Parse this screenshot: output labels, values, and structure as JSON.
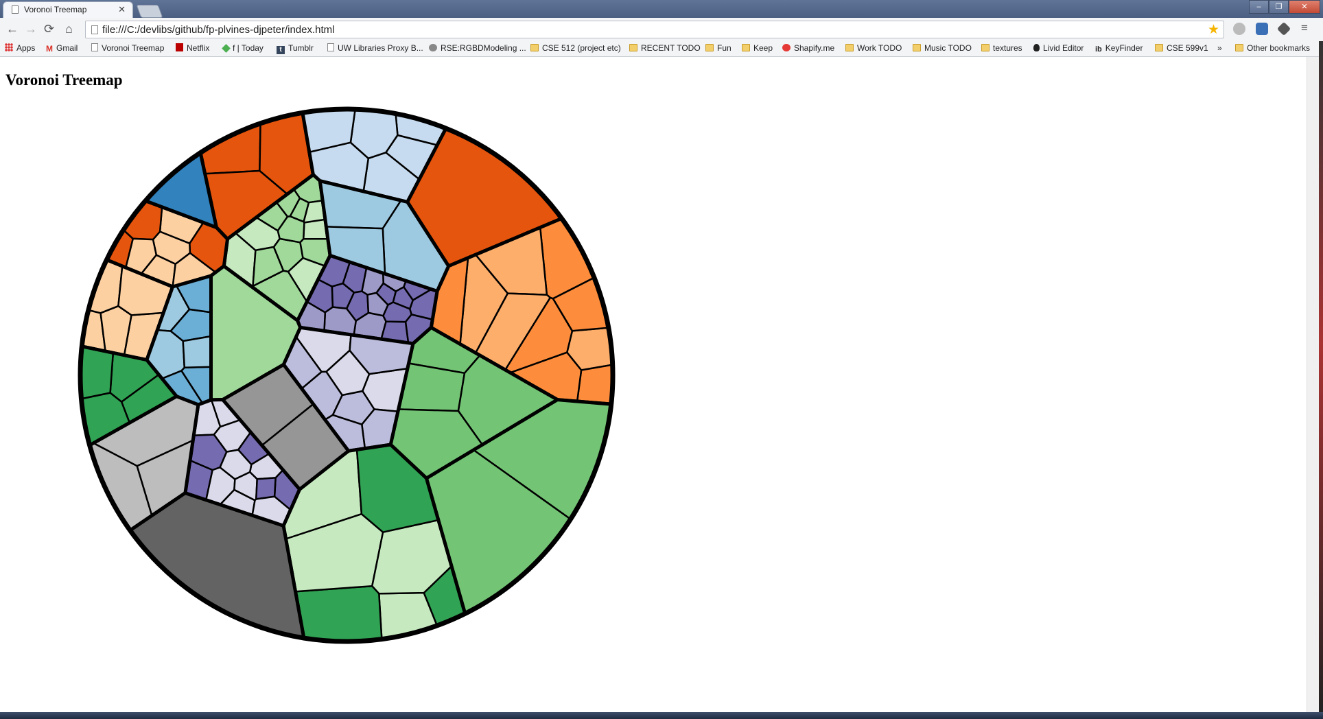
{
  "browser": {
    "tab_title": "Voronoi Treemap",
    "url": "file:///C:/devlibs/github/fp-plvines-djpeter/index.html",
    "window_buttons": [
      "–",
      "❐",
      "✕"
    ]
  },
  "bookmarks": {
    "items": [
      {
        "label": "Apps",
        "icon": "apps-icon"
      },
      {
        "label": "Gmail",
        "icon": "gmail-icon"
      },
      {
        "label": "Voronoi Treemap",
        "icon": "page-icon"
      },
      {
        "label": "Netflix",
        "icon": "netflix-icon"
      },
      {
        "label": "f | Today",
        "icon": "feedly-icon"
      },
      {
        "label": "Tumblr",
        "icon": "tumblr-icon"
      },
      {
        "label": "UW Libraries Proxy B...",
        "icon": "page-icon"
      },
      {
        "label": "RSE:RGBDModeling ...",
        "icon": "rse-icon"
      },
      {
        "label": "CSE 512 (project etc)",
        "icon": "folder-icon"
      },
      {
        "label": "RECENT TODO",
        "icon": "folder-icon"
      },
      {
        "label": "Fun",
        "icon": "folder-icon"
      },
      {
        "label": "Keep",
        "icon": "folder-icon"
      },
      {
        "label": "Shapify.me",
        "icon": "shapify-icon"
      },
      {
        "label": "Work TODO",
        "icon": "folder-icon"
      },
      {
        "label": "Music TODO",
        "icon": "folder-icon"
      },
      {
        "label": "textures",
        "icon": "folder-icon"
      },
      {
        "label": "Livid Editor",
        "icon": "livid-icon"
      },
      {
        "label": "KeyFinder",
        "icon": "keyfinder-icon"
      },
      {
        "label": "CSE 599v1",
        "icon": "folder-icon"
      }
    ],
    "overflow": "»",
    "other": "Other bookmarks"
  },
  "page": {
    "heading": "Voronoi Treemap"
  },
  "treemap": {
    "border_color": "#000000",
    "groups": [
      {
        "name": "orange",
        "colors": [
          "#e6550d",
          "#fd8d3c",
          "#fdae6b",
          "#fdd0a2"
        ]
      },
      {
        "name": "green",
        "colors": [
          "#31a354",
          "#74c476",
          "#a1d99b",
          "#c7e9c0"
        ]
      },
      {
        "name": "purple",
        "colors": [
          "#756bb1",
          "#9e9ac8",
          "#bcbddc",
          "#dadaeb"
        ]
      },
      {
        "name": "blue",
        "colors": [
          "#3182bd",
          "#6baed6",
          "#9ecae1",
          "#c6dbef"
        ]
      },
      {
        "name": "gray",
        "colors": [
          "#636363",
          "#969696",
          "#bdbdbd",
          "#d9d9d9"
        ]
      }
    ]
  }
}
